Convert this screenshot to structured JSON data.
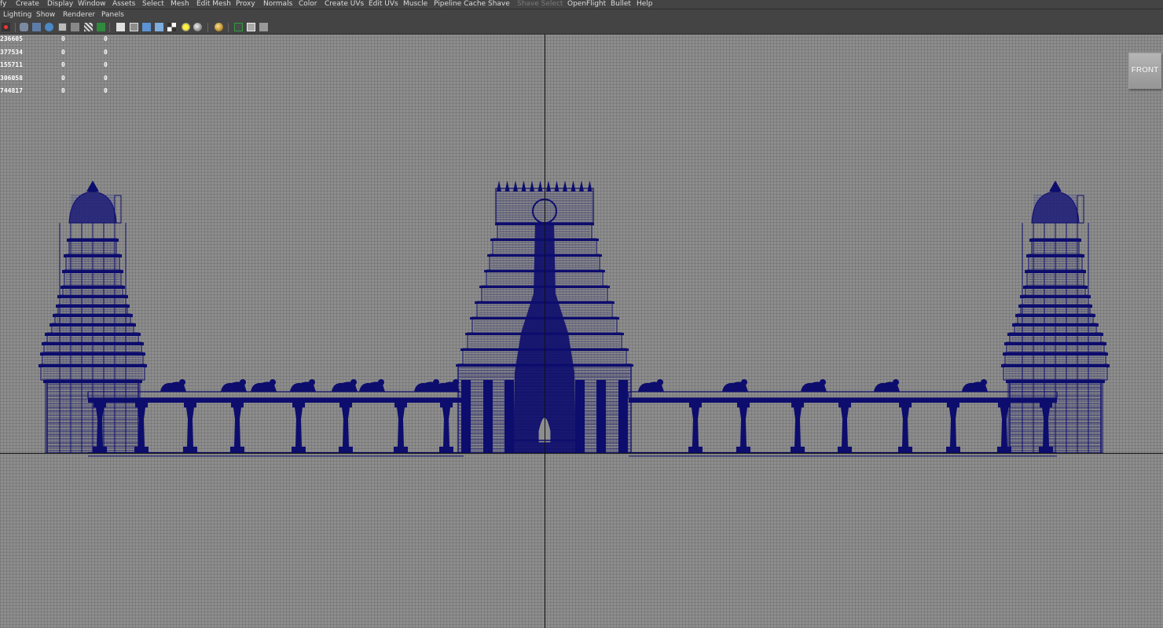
{
  "main_menu": [
    "fy",
    "Create",
    "Display",
    "Window",
    "Assets",
    "Select",
    "Mesh",
    "Edit Mesh",
    "Proxy",
    "Normals",
    "Color",
    "Create UVs",
    "Edit UVs",
    "Muscle",
    "Pipeline Cache",
    "Shave",
    "Shave Select",
    "OpenFlight",
    "Bullet",
    "Help"
  ],
  "disabled_menu": "Shave Select",
  "panel_menu": [
    "Lighting",
    "Show",
    "Renderer",
    "Panels"
  ],
  "toolbar_icons": [
    "select-camera-icon",
    "camera-attributes-icon",
    "bookmark-icon",
    "image-plane-icon",
    "grid-icon",
    "film-gate-icon",
    "resolution-gate-icon",
    "safe-action-icon",
    "field-chart-icon",
    "wireframe-icon",
    "smooth-shade-icon",
    "wireframe-on-shaded-icon",
    "textured-icon",
    "use-all-lights-icon",
    "shadows-icon",
    "ambient-occlusion-icon",
    "isolate-select-icon",
    "xray-icon",
    "xray-joints-icon",
    "xray-components-icon"
  ],
  "hud_rows": [
    {
      "label": "236605",
      "a": "0",
      "b": "0"
    },
    {
      "label": "377534",
      "a": "0",
      "b": "0"
    },
    {
      "label": "155711",
      "a": "0",
      "b": "0"
    },
    {
      "label": "306058",
      "a": "0",
      "b": "0"
    },
    {
      "label": "744817",
      "a": "0",
      "b": "0"
    }
  ],
  "view_cube_label": "FRONT",
  "colors": {
    "wireframe": "#0d0d6e",
    "background": "#8d8d8d",
    "menubar": "#444444"
  }
}
